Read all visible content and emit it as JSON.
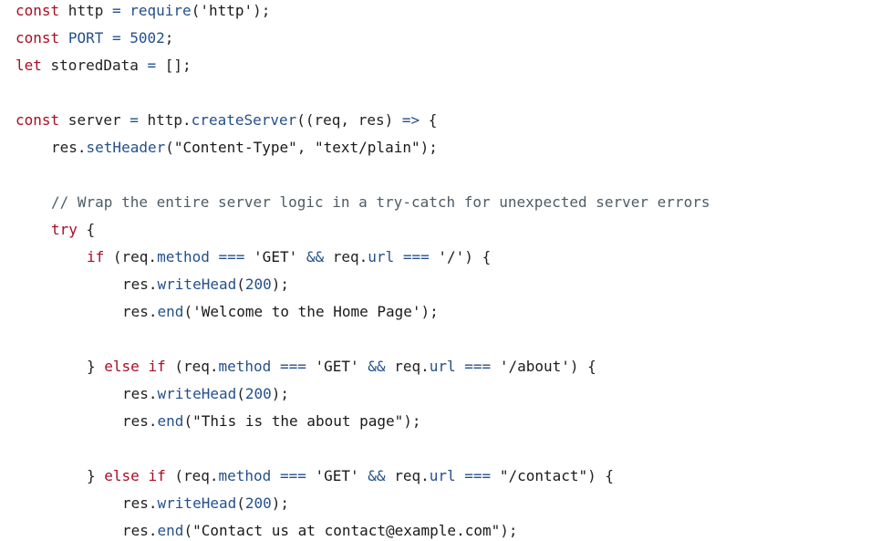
{
  "colors": {
    "background": "#ffffff",
    "keyword": "#a90d25",
    "function": "#24508c",
    "property": "#24508c",
    "number": "#24508c",
    "string": "#1a1a1a",
    "comment": "#4f5b66",
    "operator": "#24508c",
    "plain": "#222222"
  },
  "code": {
    "language": "javascript",
    "lines": [
      {
        "indent": 0,
        "tokens": [
          [
            "kw",
            "const"
          ],
          [
            "pl",
            " http "
          ],
          [
            "op",
            "="
          ],
          [
            "pl",
            " "
          ],
          [
            "fn",
            "require"
          ],
          [
            "pl",
            "("
          ],
          [
            "str",
            "'http'"
          ],
          [
            "pl",
            ");"
          ]
        ]
      },
      {
        "indent": 0,
        "tokens": [
          [
            "kw",
            "const"
          ],
          [
            "pl",
            " "
          ],
          [
            "prop",
            "PORT"
          ],
          [
            "pl",
            " "
          ],
          [
            "op",
            "="
          ],
          [
            "pl",
            " "
          ],
          [
            "num",
            "5002"
          ],
          [
            "pl",
            ";"
          ]
        ]
      },
      {
        "indent": 0,
        "tokens": [
          [
            "kw",
            "let"
          ],
          [
            "pl",
            " storedData "
          ],
          [
            "op",
            "="
          ],
          [
            "pl",
            " [];"
          ]
        ]
      },
      {
        "indent": 0,
        "tokens": []
      },
      {
        "indent": 0,
        "tokens": [
          [
            "kw",
            "const"
          ],
          [
            "pl",
            " server "
          ],
          [
            "op",
            "="
          ],
          [
            "pl",
            " http."
          ],
          [
            "fn",
            "createServer"
          ],
          [
            "pl",
            "((req, res) "
          ],
          [
            "op",
            "=>"
          ],
          [
            "pl",
            " {"
          ]
        ]
      },
      {
        "indent": 1,
        "tokens": [
          [
            "pl",
            "res."
          ],
          [
            "fn",
            "setHeader"
          ],
          [
            "pl",
            "("
          ],
          [
            "str",
            "\"Content-Type\""
          ],
          [
            "pl",
            ", "
          ],
          [
            "str",
            "\"text/plain\""
          ],
          [
            "pl",
            ");"
          ]
        ]
      },
      {
        "indent": 0,
        "tokens": []
      },
      {
        "indent": 1,
        "tokens": [
          [
            "cm",
            "// Wrap the entire server logic in a try-catch for unexpected server errors"
          ]
        ]
      },
      {
        "indent": 1,
        "tokens": [
          [
            "kw",
            "try"
          ],
          [
            "pl",
            " {"
          ]
        ]
      },
      {
        "indent": 2,
        "tokens": [
          [
            "kw",
            "if"
          ],
          [
            "pl",
            " (req."
          ],
          [
            "prop",
            "method"
          ],
          [
            "pl",
            " "
          ],
          [
            "op",
            "==="
          ],
          [
            "pl",
            " "
          ],
          [
            "str",
            "'GET'"
          ],
          [
            "pl",
            " "
          ],
          [
            "op",
            "&&"
          ],
          [
            "pl",
            " req."
          ],
          [
            "prop",
            "url"
          ],
          [
            "pl",
            " "
          ],
          [
            "op",
            "==="
          ],
          [
            "pl",
            " "
          ],
          [
            "str",
            "'/'"
          ],
          [
            "pl",
            ") {"
          ]
        ]
      },
      {
        "indent": 3,
        "tokens": [
          [
            "pl",
            "res."
          ],
          [
            "fn",
            "writeHead"
          ],
          [
            "pl",
            "("
          ],
          [
            "num",
            "200"
          ],
          [
            "pl",
            ");"
          ]
        ]
      },
      {
        "indent": 3,
        "tokens": [
          [
            "pl",
            "res."
          ],
          [
            "fn",
            "end"
          ],
          [
            "pl",
            "("
          ],
          [
            "str",
            "'Welcome to the Home Page'"
          ],
          [
            "pl",
            ");"
          ]
        ]
      },
      {
        "indent": 0,
        "tokens": []
      },
      {
        "indent": 2,
        "tokens": [
          [
            "pl",
            "} "
          ],
          [
            "kw",
            "else"
          ],
          [
            "pl",
            " "
          ],
          [
            "kw",
            "if"
          ],
          [
            "pl",
            " (req."
          ],
          [
            "prop",
            "method"
          ],
          [
            "pl",
            " "
          ],
          [
            "op",
            "==="
          ],
          [
            "pl",
            " "
          ],
          [
            "str",
            "'GET'"
          ],
          [
            "pl",
            " "
          ],
          [
            "op",
            "&&"
          ],
          [
            "pl",
            " req."
          ],
          [
            "prop",
            "url"
          ],
          [
            "pl",
            " "
          ],
          [
            "op",
            "==="
          ],
          [
            "pl",
            " "
          ],
          [
            "str",
            "'/about'"
          ],
          [
            "pl",
            ") {"
          ]
        ]
      },
      {
        "indent": 3,
        "tokens": [
          [
            "pl",
            "res."
          ],
          [
            "fn",
            "writeHead"
          ],
          [
            "pl",
            "("
          ],
          [
            "num",
            "200"
          ],
          [
            "pl",
            ");"
          ]
        ]
      },
      {
        "indent": 3,
        "tokens": [
          [
            "pl",
            "res."
          ],
          [
            "fn",
            "end"
          ],
          [
            "pl",
            "("
          ],
          [
            "str",
            "\"This is the about page\""
          ],
          [
            "pl",
            ");"
          ]
        ]
      },
      {
        "indent": 0,
        "tokens": []
      },
      {
        "indent": 2,
        "tokens": [
          [
            "pl",
            "} "
          ],
          [
            "kw",
            "else"
          ],
          [
            "pl",
            " "
          ],
          [
            "kw",
            "if"
          ],
          [
            "pl",
            " (req."
          ],
          [
            "prop",
            "method"
          ],
          [
            "pl",
            " "
          ],
          [
            "op",
            "==="
          ],
          [
            "pl",
            " "
          ],
          [
            "str",
            "'GET'"
          ],
          [
            "pl",
            " "
          ],
          [
            "op",
            "&&"
          ],
          [
            "pl",
            " req."
          ],
          [
            "prop",
            "url"
          ],
          [
            "pl",
            " "
          ],
          [
            "op",
            "==="
          ],
          [
            "pl",
            " "
          ],
          [
            "str",
            "\"/contact\""
          ],
          [
            "pl",
            ") {"
          ]
        ]
      },
      {
        "indent": 3,
        "tokens": [
          [
            "pl",
            "res."
          ],
          [
            "fn",
            "writeHead"
          ],
          [
            "pl",
            "("
          ],
          [
            "num",
            "200"
          ],
          [
            "pl",
            ");"
          ]
        ]
      },
      {
        "indent": 3,
        "tokens": [
          [
            "pl",
            "res."
          ],
          [
            "fn",
            "end"
          ],
          [
            "pl",
            "("
          ],
          [
            "str",
            "\"Contact us at contact@example.com\""
          ],
          [
            "pl",
            ");"
          ]
        ]
      }
    ]
  }
}
